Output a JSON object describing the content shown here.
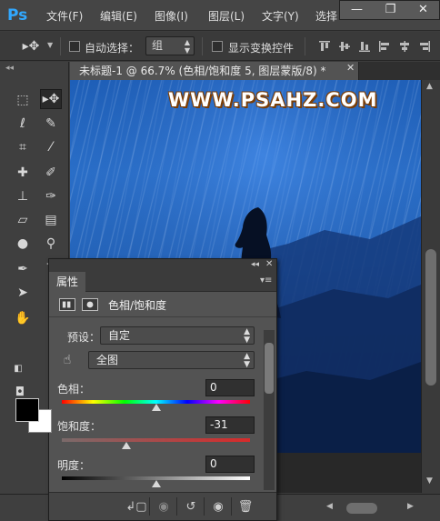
{
  "menubar": {
    "items": [
      "文件(F)",
      "编辑(E)",
      "图像(I)",
      "图层(L)",
      "文字(Y)",
      "选择"
    ]
  },
  "options": {
    "auto_select_label": "自动选择：",
    "group_value": "组",
    "show_transform_label": "显示变换控件"
  },
  "document": {
    "tab_title": "未标题-1 @ 66.7% (色相/饱和度 5, 图层蒙版/8) *",
    "watermark": "WWW.PSAHZ.COM"
  },
  "properties": {
    "tab_label": "属性",
    "title": "色相/饱和度",
    "preset_label": "预设：",
    "preset_value": "自定",
    "channel_value": "全图",
    "hue_label": "色相：",
    "hue_value": "0",
    "saturation_label": "饱和度：",
    "saturation_value": "-31",
    "lightness_label": "明度：",
    "lightness_value": "0",
    "hue_position": 0.5,
    "saturation_position": 0.345,
    "lightness_position": 0.5
  },
  "colors": {
    "foreground": "#000000",
    "background": "#ffffff",
    "ps_blue": "#31a8ff"
  },
  "icons": [
    "move-tool-icon",
    "marquee-icon",
    "lasso-icon",
    "quick-select-icon",
    "crop-icon",
    "eyedropper-icon",
    "healing-icon",
    "brush-icon",
    "stamp-icon",
    "history-brush-icon",
    "eraser-icon",
    "gradient-icon",
    "blur-icon",
    "dodge-icon",
    "pen-icon",
    "type-icon",
    "path-select-icon",
    "hand-icon",
    "zoom-icon"
  ]
}
